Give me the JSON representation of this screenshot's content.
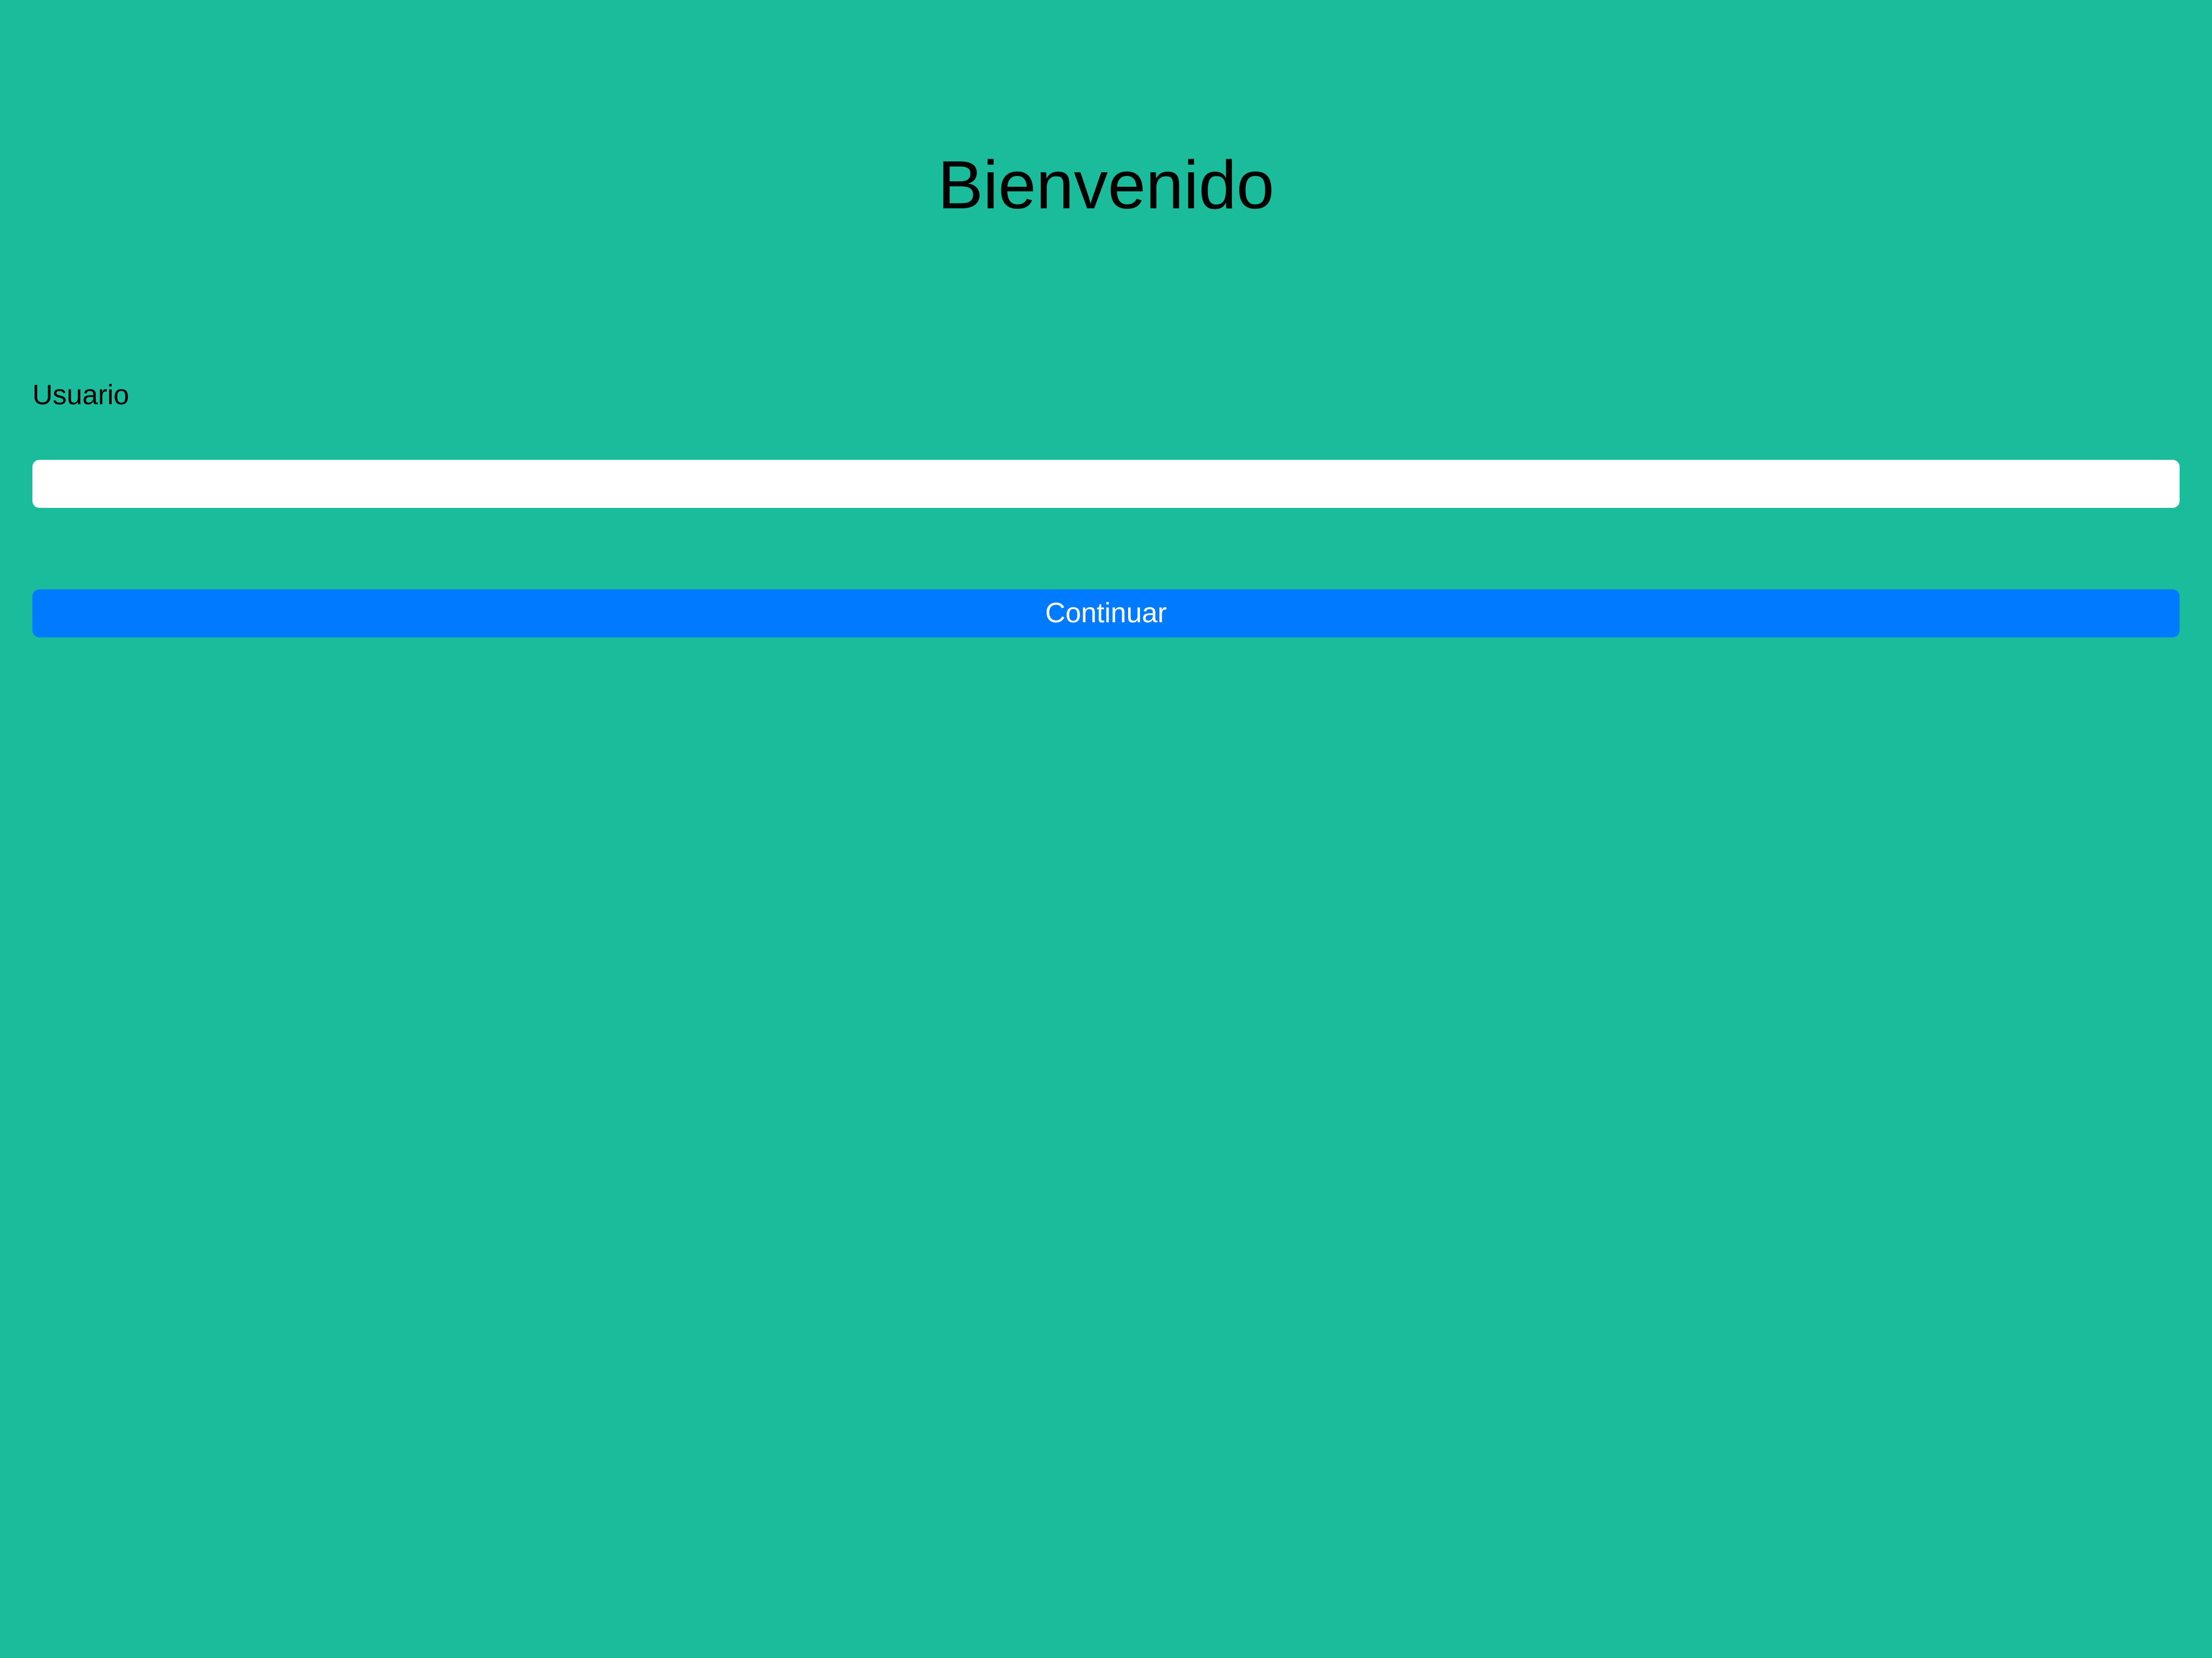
{
  "app": {
    "background_color": "#1bbc9b",
    "accent_color": "#007aff"
  },
  "header": {
    "title": "Bienvenido"
  },
  "form": {
    "username_label": "Usuario",
    "username_value": "",
    "username_placeholder": "",
    "continue_label": "Continuar"
  }
}
